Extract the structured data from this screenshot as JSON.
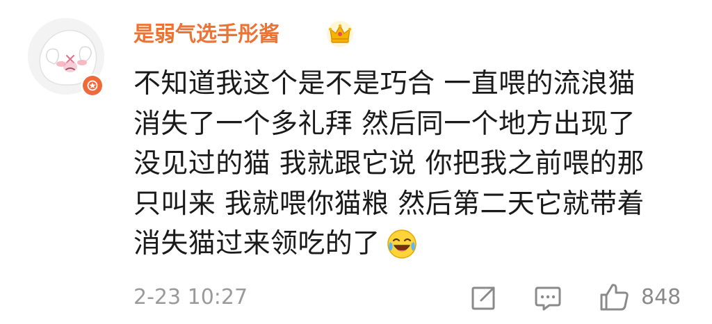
{
  "comment": {
    "username": "是弱气选手彤酱",
    "badge_icon": "crown-icon",
    "avatar_icon": "ghost-avatar",
    "verified_icon": "star-badge-icon",
    "text_lines": [
      "不知道我这个是不是巧合 一直喂的流浪猫",
      "消失了一个多礼拜 然后同一个地方出现了",
      "没见过的猫 我就跟它说 你把我之前喂的那",
      "只叫来 我就喂你猫粮 然后第二天它就带着",
      "消失猫过来领吃的了"
    ],
    "trailing_emoji": "laugh-cry-emoji",
    "timestamp": "2-23 10:27",
    "actions": {
      "share_icon": "share-icon",
      "comment_icon": "comment-icon",
      "like_icon": "thumbs-up-icon",
      "like_count": "848"
    },
    "colors": {
      "username": "#eb7335",
      "text": "#1a1a1a",
      "meta": "#9a9a9a",
      "badge": "#ee6a3b",
      "crown": "#f5b400"
    }
  }
}
